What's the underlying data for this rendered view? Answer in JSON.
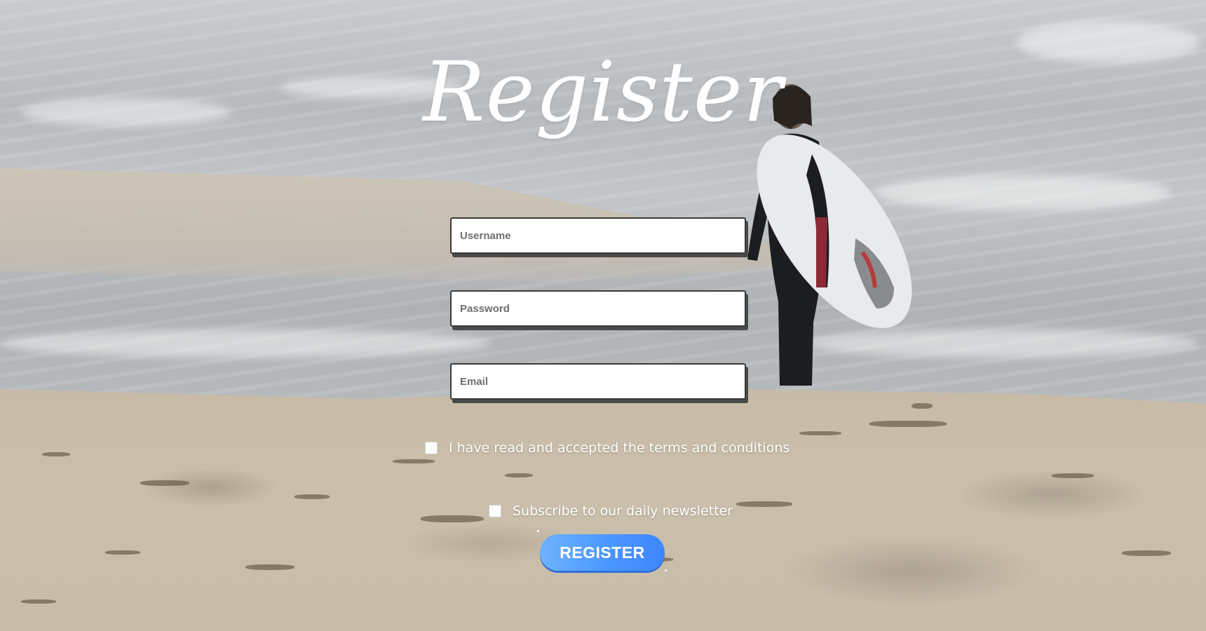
{
  "page": {
    "title": "Register"
  },
  "form": {
    "username": {
      "placeholder": "Username",
      "value": ""
    },
    "password": {
      "placeholder": "Password",
      "value": ""
    },
    "email": {
      "placeholder": "Email",
      "value": ""
    },
    "terms_label": "I have read and accepted the terms and conditions",
    "terms_checked": false,
    "newsletter_label": "Subscribe to our daily newsletter",
    "newsletter_checked": false,
    "submit_label": "REGISTER"
  },
  "colors": {
    "button_gradient_start": "#6fb3ff",
    "button_gradient_end": "#3f86ff",
    "field_border": "#3a3a3a",
    "text": "#ffffff"
  }
}
